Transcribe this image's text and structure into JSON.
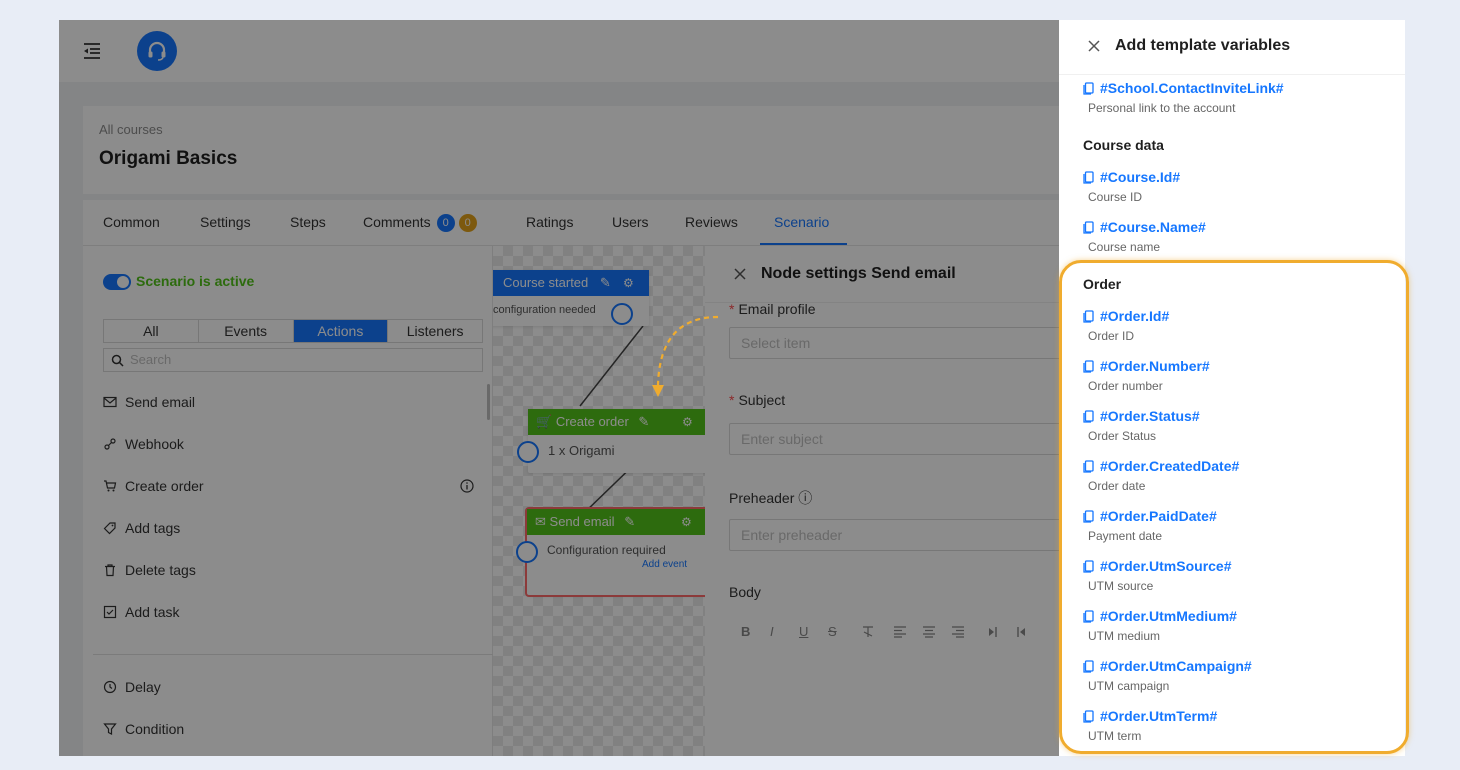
{
  "course": {
    "breadcrumb": "All courses",
    "title": "Origami Basics"
  },
  "tabs": [
    {
      "label": "Common"
    },
    {
      "label": "Settings"
    },
    {
      "label": "Steps"
    },
    {
      "label": "Comments",
      "badges": [
        "0",
        "0"
      ]
    },
    {
      "label": "Ratings"
    },
    {
      "label": "Users"
    },
    {
      "label": "Reviews"
    },
    {
      "label": "Scenario",
      "active": true
    }
  ],
  "scenario": {
    "toggle_label": "Scenario is active",
    "filters": [
      "All",
      "Events",
      "Actions",
      "Listeners"
    ],
    "active_filter": "Actions",
    "search_placeholder": "Search",
    "actions": [
      {
        "label": "Send email",
        "icon": "mail-icon"
      },
      {
        "label": "Webhook",
        "icon": "webhook-icon"
      },
      {
        "label": "Create order",
        "icon": "cart-icon"
      },
      {
        "label": "Add tags",
        "icon": "tag-icon"
      },
      {
        "label": "Delete tags",
        "icon": "trash-icon"
      },
      {
        "label": "Add task",
        "icon": "checkbox-icon"
      }
    ],
    "controls": [
      {
        "label": "Delay",
        "icon": "clock-icon"
      },
      {
        "label": "Condition",
        "icon": "filter-icon"
      }
    ]
  },
  "nodes": {
    "course_started": {
      "title": "Course started",
      "body": "configuration needed"
    },
    "create_order": {
      "title": "Create order",
      "body": "1 x Origami"
    },
    "send_email": {
      "title": "Send email",
      "body": "Configuration required",
      "link": "Add event"
    }
  },
  "node_settings": {
    "title": "Node settings Send email",
    "email_profile": {
      "label": "Email profile",
      "placeholder": "Select item"
    },
    "subject": {
      "label": "Subject",
      "placeholder": "Enter subject"
    },
    "preheader": {
      "label": "Preheader",
      "placeholder": "Enter preheader"
    },
    "body_label": "Body",
    "toolbar": [
      "B",
      "I",
      "U",
      "S"
    ]
  },
  "drawer": {
    "title": "Add template variables",
    "vars_top": [
      {
        "code": "#School.ContactInviteLink#",
        "desc": "Personal link to the account"
      }
    ],
    "course_section": {
      "title": "Course data",
      "vars": [
        {
          "code": "#Course.Id#",
          "desc": "Course ID"
        },
        {
          "code": "#Course.Name#",
          "desc": "Course name"
        }
      ]
    },
    "order_section": {
      "title": "Order",
      "vars": [
        {
          "code": "#Order.Id#",
          "desc": "Order ID"
        },
        {
          "code": "#Order.Number#",
          "desc": "Order number"
        },
        {
          "code": "#Order.Status#",
          "desc": "Order Status"
        },
        {
          "code": "#Order.CreatedDate#",
          "desc": "Order date"
        },
        {
          "code": "#Order.PaidDate#",
          "desc": "Payment date"
        },
        {
          "code": "#Order.UtmSource#",
          "desc": "UTM source"
        },
        {
          "code": "#Order.UtmMedium#",
          "desc": "UTM medium"
        },
        {
          "code": "#Order.UtmCampaign#",
          "desc": "UTM campaign"
        },
        {
          "code": "#Order.UtmTerm#",
          "desc": "UTM term"
        }
      ]
    }
  },
  "colors": {
    "accent": "#1677ff",
    "active_green": "#52c41a",
    "node_green": "#52c41a",
    "highlight": "#f0ac2e",
    "badge_gold": "#e3a21a"
  }
}
